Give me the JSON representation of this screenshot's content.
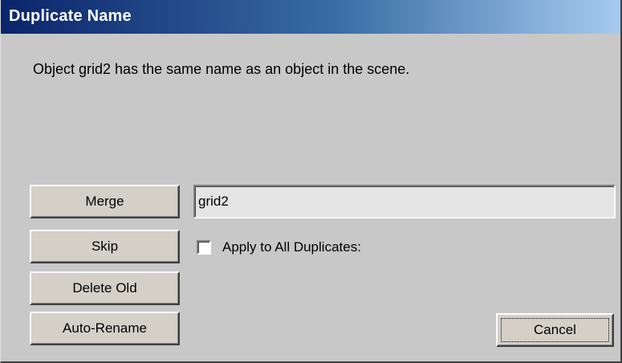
{
  "window": {
    "title": "Duplicate Name"
  },
  "message": "Object grid2 has the same name as an object in the scene.",
  "buttons": {
    "merge": "Merge",
    "skip": "Skip",
    "delete_old": "Delete Old",
    "auto_rename": "Auto-Rename",
    "cancel": "Cancel"
  },
  "name_field": {
    "value": "grid2"
  },
  "apply_all": {
    "label": "Apply to All Duplicates:",
    "checked": false
  },
  "colors": {
    "titlebar_start": "#0a246a",
    "titlebar_end": "#a6caf0",
    "dialog_bg": "#c8c8c8"
  }
}
